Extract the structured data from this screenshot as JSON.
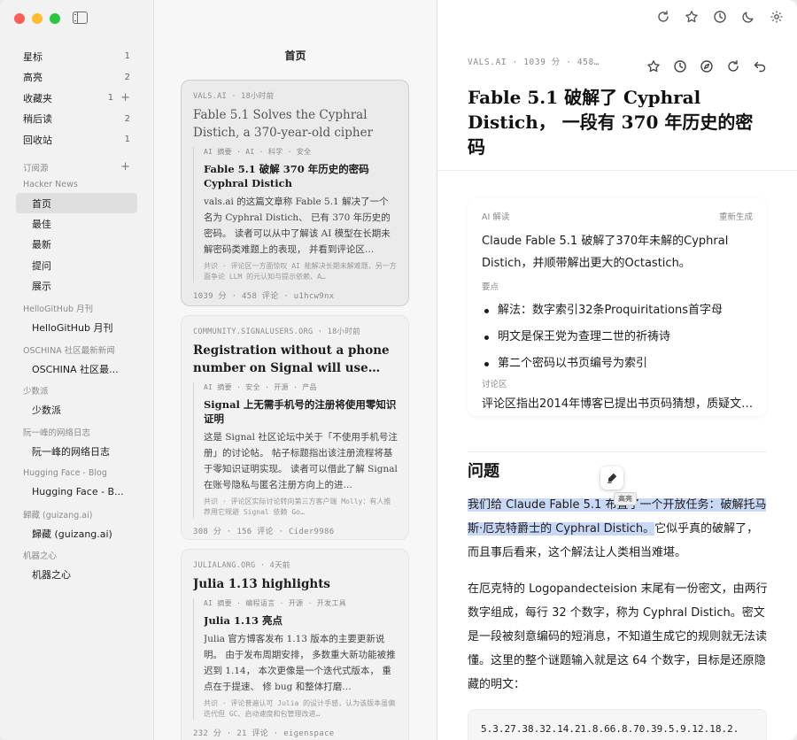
{
  "sidebar": {
    "nav": [
      {
        "label": "星标",
        "count": "1"
      },
      {
        "label": "高亮",
        "count": "2"
      },
      {
        "label": "收藏夹",
        "count": "1",
        "plus": "+"
      },
      {
        "label": "稍后读",
        "count": "2"
      },
      {
        "label": "回收站",
        "count": "1"
      }
    ],
    "subscriptions_label": "订阅源",
    "subscriptions_plus": "+",
    "groups": [
      {
        "title": "Hacker News",
        "feeds": [
          "首页",
          "最佳",
          "最新",
          "提问",
          "展示"
        ]
      },
      {
        "title": "HelloGitHub 月刊",
        "feeds": [
          "HelloGitHub 月刊"
        ]
      },
      {
        "title": "OSCHINA 社区最新新闻",
        "feeds": [
          "OSCHINA 社区最..."
        ]
      },
      {
        "title": "少数派",
        "feeds": [
          "少数派"
        ]
      },
      {
        "title": "阮一峰的网络日志",
        "feeds": [
          "阮一峰的网络日志"
        ]
      },
      {
        "title": "Hugging Face - Blog",
        "feeds": [
          "Hugging Face - B..."
        ]
      },
      {
        "title": "歸藏 (guizang.ai)",
        "feeds": [
          "歸藏 (guizang.ai)"
        ]
      },
      {
        "title": "机器之心",
        "feeds": [
          "机器之心"
        ]
      }
    ]
  },
  "list": {
    "title": "首页",
    "cards": [
      {
        "meta": "VALS.AI · 18小时前",
        "title": "Fable 5.1 Solves the Cyphral Distich, a 370-year-old cipher",
        "tags": "AI 摘要 · AI · 科学 · 安全",
        "ai_title": "Fable 5.1 破解 370 年历史的密码 Cyphral Distich",
        "summary": "vals.ai 的这篇文章称 Fable 5.1 解决了一个名为 Cyphral Distich、 已有 370 年历史的密码。 读者可以从中了解该 AI 模型在长期未解密码类难题上的表现， 并看到评论区…",
        "comment": "共识 · 评论区一方面惊叹 AI 能解决长期未解难题，另一方面争论 LLM 的元认知与提示依赖、A…",
        "stats": "1039 分 · 458 评论 · u1hcw9nx"
      },
      {
        "meta": "COMMUNITY.SIGNALUSERS.ORG · 18小时前",
        "title": "Registration without a phone number on Signal will use zero-…",
        "tags": "AI 摘要 · 安全 · 开源 · 产品",
        "ai_title": "Signal 上无需手机号的注册将使用零知识证明",
        "summary": "这是 Signal 社区论坛中关于「不使用手机号注册」的讨论帖。 帖子标题指出该注册流程将基于零知识证明实现。 读者可以借此了解 Signal 在账号隐私与匿名注册方向上的进…",
        "comment": "共识 · 评论区实际讨论转向第三方客户端 Molly：有人推荐用它规避 Signal 依赖 Go…",
        "stats": "308 分 · 156 评论 · Cider9986"
      },
      {
        "meta": "JULIALANG.ORG · 4天前",
        "title": "Julia 1.13 highlights",
        "tags": "AI 摘要 · 编程语言 · 开源 · 开发工具",
        "ai_title": "Julia 1.13 亮点",
        "summary": "Julia 官方博客发布 1.13 版本的主要更新说明。 由于发布周期安排， 多数重大新功能被推迟到 1.14， 本次更像是一个迭代式版本， 重点在于提速、 修 bug 和整体打磨…",
        "comment": "共识 · 评论普遍认可 Julia 的设计手感，认为该版本虽偏迭代但 GC、启动速度和包管理改进…",
        "stats": "232 分 · 21 评论 · eigenspace"
      }
    ]
  },
  "reader": {
    "meta": "VALS.AI · 1039 分 · 458…",
    "title": "Fable 5.1 破解了 Cyphral Distich， 一段有 370 年历史的密码",
    "ai_panel": {
      "label": "AI 解读",
      "regenerate": "重新生成",
      "summary": "Claude Fable 5.1 破解了370年未解的Cyphral Distich，并顺带解出更大的Octastich。",
      "points_label": "要点",
      "points": [
        "解法：数字索引32条Proquiritations首字母",
        "明文是保王党为查理二世的祈祷诗",
        "第二个密码以书页编号为索引"
      ],
      "comments_label": "讨论区",
      "comments_text": "评论区指出2014年博客已提出书页码猜想，质疑文…"
    },
    "section_title": "问题",
    "para1_highlight": "我们给 Claude Fable 5.1 布置了一个开放任务：破解托马斯·厄克特爵士的 Cyphral Distich。",
    "para1_rest": "它似乎真的破解了，而且事后看来，这个解法让人类相当难堪。",
    "para2": "在厄克特的 Logopandecteision 末尾有一份密文，由两行数字组成，每行 32 个数字，称为 Cyphral Distich。密文是一段被刻意编码的短消息，不知道生成它的规则就无法读懂。这里的整个谜题输入就是这 64 个数字，目标是还原隐藏的明文：",
    "code": "5.3.27.38.32.14.21.8.66.8.70.39.5.9.12.18.2.",
    "tooltip": "高亮"
  }
}
